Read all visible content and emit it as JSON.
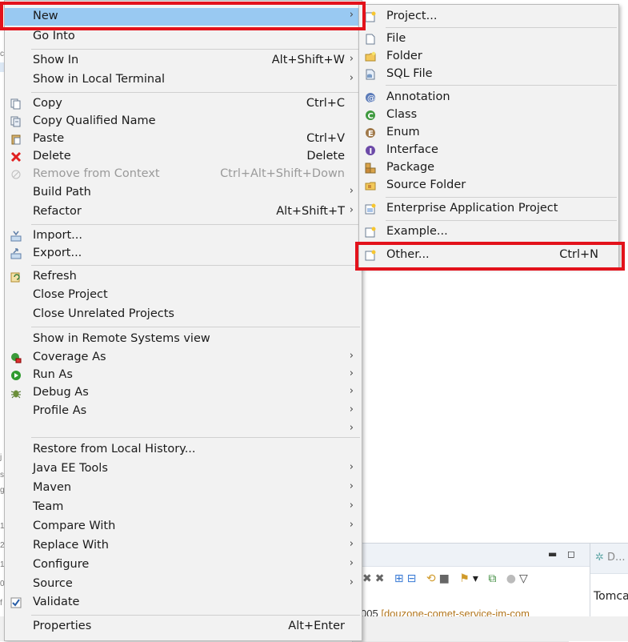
{
  "menu": {
    "items": [
      {
        "label": "New",
        "shortcut": "",
        "arrow": true,
        "icon": "",
        "selected": true
      },
      {
        "label": "Go Into",
        "shortcut": "",
        "arrow": false,
        "icon": ""
      },
      {
        "label": "Show In",
        "shortcut": "Alt+Shift+W",
        "arrow": true,
        "icon": ""
      },
      {
        "label": "Show in Local Terminal",
        "shortcut": "",
        "arrow": true,
        "icon": ""
      },
      {
        "label": "Copy",
        "shortcut": "Ctrl+C",
        "arrow": false,
        "icon": "copy-icon"
      },
      {
        "label": "Copy Qualified Name",
        "shortcut": "",
        "arrow": false,
        "icon": "copy-qualified-icon"
      },
      {
        "label": "Paste",
        "shortcut": "Ctrl+V",
        "arrow": false,
        "icon": "paste-icon"
      },
      {
        "label": "Delete",
        "shortcut": "Delete",
        "arrow": false,
        "icon": "delete-icon"
      },
      {
        "label": "Remove from Context",
        "shortcut": "Ctrl+Alt+Shift+Down",
        "arrow": false,
        "icon": "remove-context-icon",
        "disabled": true
      },
      {
        "label": "Build Path",
        "shortcut": "",
        "arrow": true,
        "icon": ""
      },
      {
        "label": "Refactor",
        "shortcut": "Alt+Shift+T",
        "arrow": true,
        "icon": ""
      },
      {
        "label": "Import...",
        "shortcut": "",
        "arrow": false,
        "icon": "import-icon"
      },
      {
        "label": "Export...",
        "shortcut": "",
        "arrow": false,
        "icon": "export-icon"
      },
      {
        "label": "Refresh",
        "shortcut": "",
        "arrow": false,
        "icon": "refresh-icon"
      },
      {
        "label": "Close Project",
        "shortcut": "",
        "arrow": false,
        "icon": ""
      },
      {
        "label": "Close Unrelated Projects",
        "shortcut": "",
        "arrow": false,
        "icon": ""
      },
      {
        "label": "Show in Remote Systems view",
        "shortcut": "",
        "arrow": false,
        "icon": ""
      },
      {
        "label": "Coverage As",
        "shortcut": "",
        "arrow": true,
        "icon": "coverage-icon"
      },
      {
        "label": "Run As",
        "shortcut": "",
        "arrow": true,
        "icon": "run-icon"
      },
      {
        "label": "Debug As",
        "shortcut": "",
        "arrow": true,
        "icon": "debug-icon"
      },
      {
        "label": "Profile As",
        "shortcut": "",
        "arrow": true,
        "icon": ""
      },
      {
        "label": "",
        "shortcut": "",
        "arrow": true,
        "icon": ""
      },
      {
        "label": "Restore from Local History...",
        "shortcut": "",
        "arrow": false,
        "icon": ""
      },
      {
        "label": "Java EE Tools",
        "shortcut": "",
        "arrow": true,
        "icon": ""
      },
      {
        "label": "Maven",
        "shortcut": "",
        "arrow": true,
        "icon": ""
      },
      {
        "label": "Team",
        "shortcut": "",
        "arrow": true,
        "icon": ""
      },
      {
        "label": "Compare With",
        "shortcut": "",
        "arrow": true,
        "icon": ""
      },
      {
        "label": "Replace With",
        "shortcut": "",
        "arrow": true,
        "icon": ""
      },
      {
        "label": "Configure",
        "shortcut": "",
        "arrow": true,
        "icon": ""
      },
      {
        "label": "Source",
        "shortcut": "",
        "arrow": true,
        "icon": ""
      },
      {
        "label": "Validate",
        "shortcut": "",
        "arrow": false,
        "icon": "checkbox-checked-icon"
      },
      {
        "label": "Properties",
        "shortcut": "Alt+Enter",
        "arrow": false,
        "icon": ""
      }
    ]
  },
  "submenu": {
    "items": [
      {
        "label": "Project...",
        "shortcut": "",
        "icon": "new-project-icon"
      },
      {
        "label": "File",
        "shortcut": "",
        "icon": "file-icon"
      },
      {
        "label": "Folder",
        "shortcut": "",
        "icon": "folder-icon"
      },
      {
        "label": "SQL File",
        "shortcut": "",
        "icon": "sql-file-icon"
      },
      {
        "label": "Annotation",
        "shortcut": "",
        "icon": "annotation-icon"
      },
      {
        "label": "Class",
        "shortcut": "",
        "icon": "class-icon"
      },
      {
        "label": "Enum",
        "shortcut": "",
        "icon": "enum-icon"
      },
      {
        "label": "Interface",
        "shortcut": "",
        "icon": "interface-icon"
      },
      {
        "label": "Package",
        "shortcut": "",
        "icon": "package-icon"
      },
      {
        "label": "Source Folder",
        "shortcut": "",
        "icon": "source-folder-icon"
      },
      {
        "label": "Enterprise Application Project",
        "shortcut": "",
        "icon": "ear-project-icon"
      },
      {
        "label": "Example...",
        "shortcut": "",
        "icon": "example-icon"
      },
      {
        "label": "Other...",
        "shortcut": "Ctrl+N",
        "icon": "new-wizard-icon"
      }
    ]
  },
  "background": {
    "console_line_number": "005",
    "console_text": "[douzone-comet-service-im-com",
    "side_tab_label": "D...",
    "side_panel_text": "Tomca"
  },
  "colors": {
    "selection": "#99c9f2",
    "highlight_box": "#e3121b",
    "menu_bg": "#f2f2f2"
  }
}
